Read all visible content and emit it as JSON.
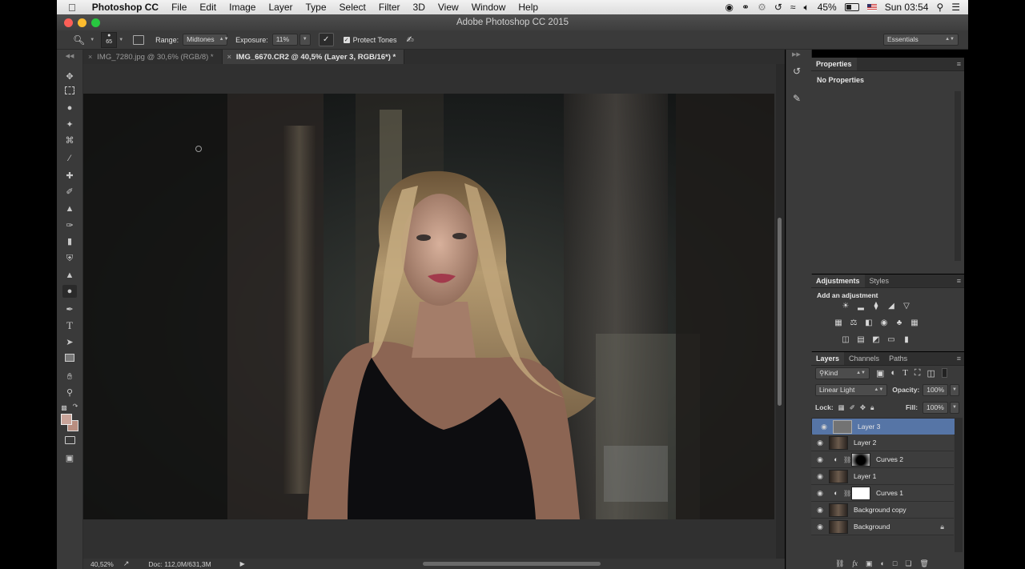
{
  "menubar": {
    "app_name": "Photoshop CC",
    "items": [
      "File",
      "Edit",
      "Image",
      "Layer",
      "Type",
      "Select",
      "Filter",
      "3D",
      "View",
      "Window",
      "Help"
    ],
    "battery": "45%",
    "clock": "Sun 03:54"
  },
  "window": {
    "title": "Adobe Photoshop CC 2015"
  },
  "options": {
    "brush_size": "65",
    "range_label": "Range:",
    "range_value": "Midtones",
    "exposure_label": "Exposure:",
    "exposure_value": "11%",
    "protect_tones_label": "Protect Tones",
    "protect_tones_checked": true,
    "workspace": "Essentials"
  },
  "tabs": [
    {
      "label": "IMG_7280.jpg @ 30,6% (RGB/8) *",
      "active": false
    },
    {
      "label": "IMG_6670.CR2 @ 40,5% (Layer 3, RGB/16*) *",
      "active": true
    }
  ],
  "status": {
    "zoom": "40,52%",
    "doc": "Doc: 112,0M/631,3M"
  },
  "colors": {
    "foreground": "#c9a49a",
    "background": "#b98e80",
    "selection": "#5675a6",
    "accent": "#4a90e2"
  },
  "properties": {
    "tab": "Properties",
    "message": "No Properties"
  },
  "adjustments": {
    "tabs": [
      "Adjustments",
      "Styles"
    ],
    "heading": "Add an adjustment"
  },
  "layers_panel": {
    "tabs": [
      "Layers",
      "Channels",
      "Paths"
    ],
    "filter_kind": "Kind",
    "blend_mode": "Linear Light",
    "opacity_label": "Opacity:",
    "opacity_value": "100%",
    "lock_label": "Lock:",
    "fill_label": "Fill:",
    "fill_value": "100%",
    "layers": [
      {
        "name": "Layer 3",
        "kind": "pixel-gray",
        "selected": true
      },
      {
        "name": "Layer 2",
        "kind": "pixel-photo",
        "selected": false
      },
      {
        "name": "Curves 2",
        "kind": "adjustment-mask-dark",
        "selected": false
      },
      {
        "name": "Layer 1",
        "kind": "pixel-photo",
        "selected": false
      },
      {
        "name": "Curves 1",
        "kind": "adjustment-mask-white",
        "selected": false
      },
      {
        "name": "Background copy",
        "kind": "pixel-photo",
        "selected": false
      },
      {
        "name": "Background",
        "kind": "pixel-photo-locked",
        "selected": false
      }
    ]
  }
}
